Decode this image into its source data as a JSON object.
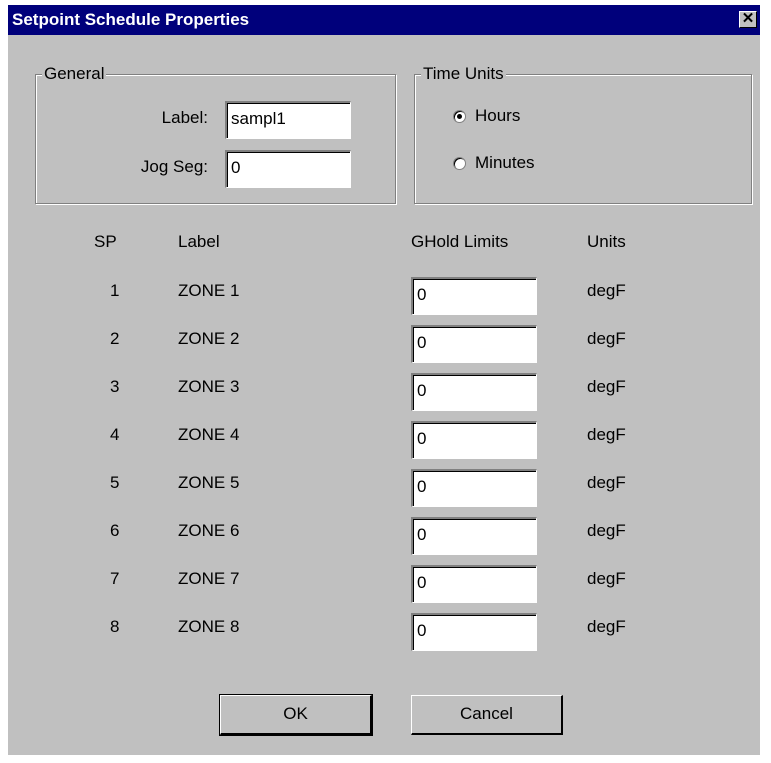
{
  "window": {
    "title": "Setpoint Schedule Properties",
    "close_label": "✕"
  },
  "general": {
    "legend": "General",
    "label_caption": "Label:",
    "label_value": "sampl1",
    "jogseg_caption": "Jog Seg:",
    "jogseg_value": "0"
  },
  "time_units": {
    "legend": "Time Units",
    "options": [
      {
        "label": "Hours",
        "checked": true
      },
      {
        "label": "Minutes",
        "checked": false
      }
    ]
  },
  "table": {
    "headers": {
      "sp": "SP",
      "label": "Label",
      "limits": "GHold Limits",
      "units": "Units"
    },
    "rows": [
      {
        "sp": "1",
        "label": "ZONE 1",
        "limit": "0",
        "units": "degF"
      },
      {
        "sp": "2",
        "label": "ZONE 2",
        "limit": "0",
        "units": "degF"
      },
      {
        "sp": "3",
        "label": "ZONE 3",
        "limit": "0",
        "units": "degF"
      },
      {
        "sp": "4",
        "label": "ZONE 4",
        "limit": "0",
        "units": "degF"
      },
      {
        "sp": "5",
        "label": "ZONE 5",
        "limit": "0",
        "units": "degF"
      },
      {
        "sp": "6",
        "label": "ZONE 6",
        "limit": "0",
        "units": "degF"
      },
      {
        "sp": "7",
        "label": "ZONE 7",
        "limit": "0",
        "units": "degF"
      },
      {
        "sp": "8",
        "label": "ZONE 8",
        "limit": "0",
        "units": "degF"
      }
    ]
  },
  "buttons": {
    "ok": "OK",
    "cancel": "Cancel"
  },
  "colors": {
    "titlebar": "#00007b",
    "face": "#c0c0c0"
  }
}
